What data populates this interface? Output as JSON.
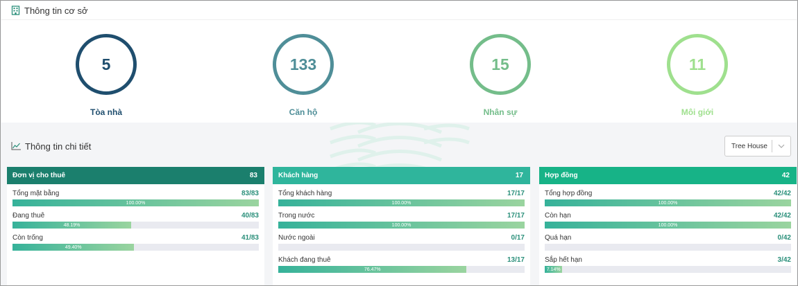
{
  "header": {
    "title": "Thông tin cơ sở"
  },
  "stats": [
    {
      "value": "5",
      "label": "Tòa nhà",
      "color": "#1f4e6e"
    },
    {
      "value": "133",
      "label": "Căn hộ",
      "color": "#4f8e98"
    },
    {
      "value": "15",
      "label": "Nhân sự",
      "color": "#74bd8a"
    },
    {
      "value": "11",
      "label": "Môi giới",
      "color": "#9fe08e"
    }
  ],
  "detail": {
    "title": "Thông tin chi tiết",
    "select_value": "Tree House"
  },
  "cards": [
    {
      "title": "Đơn vị cho thuê",
      "total": "83",
      "color": "#1b7f6d",
      "rows": [
        {
          "name": "Tổng mặt bằng",
          "value": "83/83",
          "percent": "100.00%",
          "fraction": 1.0
        },
        {
          "name": "Đang thuê",
          "value": "40/83",
          "percent": "48.19%",
          "fraction": 0.4819
        },
        {
          "name": "Còn trống",
          "value": "41/83",
          "percent": "49.40%",
          "fraction": 0.494
        }
      ]
    },
    {
      "title": "Khách hàng",
      "total": "17",
      "color": "#2fb59c",
      "rows": [
        {
          "name": "Tổng khách hàng",
          "value": "17/17",
          "percent": "100.00%",
          "fraction": 1.0
        },
        {
          "name": "Trong nước",
          "value": "17/17",
          "percent": "100.00%",
          "fraction": 1.0
        },
        {
          "name": "Nước ngoài",
          "value": "0/17",
          "percent": "",
          "fraction": 0
        },
        {
          "name": "Khách đang thuê",
          "value": "13/17",
          "percent": "76.47%",
          "fraction": 0.7647
        }
      ]
    },
    {
      "title": "Hợp đồng",
      "total": "42",
      "color": "#17b387",
      "rows": [
        {
          "name": "Tổng hợp đồng",
          "value": "42/42",
          "percent": "100.00%",
          "fraction": 1.0
        },
        {
          "name": "Còn hạn",
          "value": "42/42",
          "percent": "100.00%",
          "fraction": 1.0
        },
        {
          "name": "Quá hạn",
          "value": "0/42",
          "percent": "",
          "fraction": 0
        },
        {
          "name": "Sắp hết hạn",
          "value": "3/42",
          "percent": "7.14%",
          "fraction": 0.0714
        }
      ]
    }
  ]
}
